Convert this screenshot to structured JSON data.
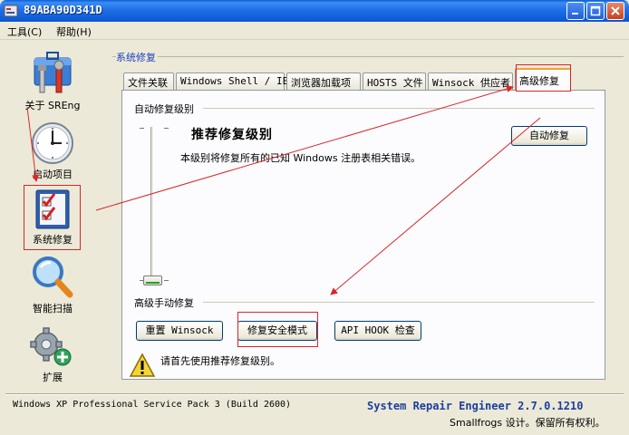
{
  "window": {
    "title": "89ABA90D341D"
  },
  "menu": [
    {
      "label": "工具(C)"
    },
    {
      "label": "帮助(H)"
    }
  ],
  "sidebar": {
    "items": [
      {
        "label": "关于 SREng",
        "icon": "toolbox-icon"
      },
      {
        "label": "启动项目",
        "icon": "clock-icon"
      },
      {
        "label": "系统修复",
        "icon": "checklist-icon",
        "selected": true
      },
      {
        "label": "智能扫描",
        "icon": "magnifier-icon"
      },
      {
        "label": "扩展",
        "icon": "gears-icon"
      }
    ]
  },
  "group": {
    "title": "系统修复"
  },
  "tabs": [
    {
      "label": "文件关联"
    },
    {
      "label": "Windows Shell / IE"
    },
    {
      "label": "浏览器加载项"
    },
    {
      "label": "HOSTS 文件"
    },
    {
      "label": "Winsock 供应者"
    },
    {
      "label": "高级修复",
      "active": true
    }
  ],
  "auto_repair": {
    "section_label": "自动修复级别",
    "heading": "推荐修复级别",
    "description": "本级别将修复所有的已知 Windows 注册表相关错误。",
    "button": "自动修复",
    "slider_level": 0
  },
  "advanced_manual": {
    "section_label": "高级手动修复",
    "buttons": [
      {
        "label": "重置 Winsock"
      },
      {
        "label": "修复安全模式"
      },
      {
        "label": "API HOOK 检查"
      }
    ]
  },
  "warning": {
    "text": "请首先使用推荐修复级别。"
  },
  "status": {
    "os": "Windows XP Professional Service Pack 3 (Build 2600)",
    "product": "System Repair Engineer 2.7.0.1210",
    "copyright": "Smallfrogs 设计。保留所有权利。"
  },
  "colors": {
    "annotation": "#d8262a",
    "product_text": "#1c3f9f",
    "group_title": "#1c3fbf"
  }
}
